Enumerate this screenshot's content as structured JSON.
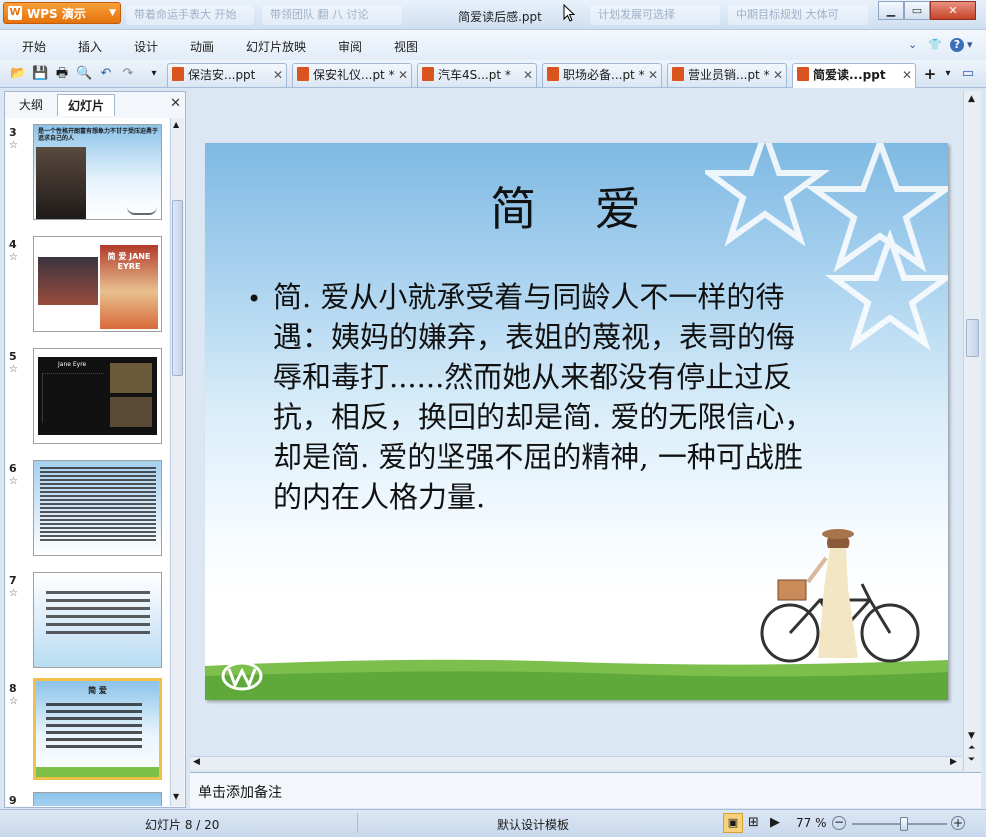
{
  "app": {
    "name": "WPS 演示",
    "doc_title": "简爱读后感.ppt"
  },
  "background_tabs": [
    "带着命运手表大 开始",
    "带领团队 翻 八 讨论",
    "计划发展可选择",
    "中期目标规划 大体可"
  ],
  "menu": {
    "items": [
      "开始",
      "插入",
      "设计",
      "动画",
      "幻灯片放映",
      "审阅",
      "视图"
    ],
    "help": "?"
  },
  "doc_tabs": [
    {
      "label": "保洁安...ppt",
      "active": false
    },
    {
      "label": "保安礼仪...pt *",
      "active": false
    },
    {
      "label": "汽车4S...pt *",
      "active": false
    },
    {
      "label": "职场必备...pt *",
      "active": false
    },
    {
      "label": "营业员销...pt *",
      "active": false
    },
    {
      "label": "简爱读...ppt",
      "active": true
    }
  ],
  "panel": {
    "tabs": [
      "大纲",
      "幻灯片"
    ],
    "active_tab": "幻灯片"
  },
  "thumbnails": [
    {
      "num": "3",
      "text": "是一个性格开朗富有想象力不甘于受压迫勇于追求自己的人"
    },
    {
      "num": "4",
      "text": "简 爱 JANE EYRE"
    },
    {
      "num": "5",
      "text": "Jane Eyre"
    },
    {
      "num": "6",
      "text": ""
    },
    {
      "num": "7",
      "text": ""
    },
    {
      "num": "8",
      "text": "简 爱",
      "selected": true
    },
    {
      "num": "9",
      "text": ""
    }
  ],
  "slide": {
    "title": "简 爱",
    "body": "简. 爱从小就承受着与同龄人不一样的待遇：姨妈的嫌弃，表姐的蔑视，表哥的侮辱和毒打......然而她从来都没有停止过反抗，相反，换回的却是简. 爱的无限信心，却是简. 爱的坚强不屈的精神, 一种可战胜的内在人格力量."
  },
  "notes": {
    "placeholder": "单击添加备注"
  },
  "status": {
    "slide_counter": "幻灯片 8 / 20",
    "template": "默认设计模板",
    "zoom": "77 %",
    "zoom_level": 0.55
  },
  "colors": {
    "accent": "#e5720c",
    "chrome": "#dbe6f3",
    "selection": "#f0c04a"
  }
}
